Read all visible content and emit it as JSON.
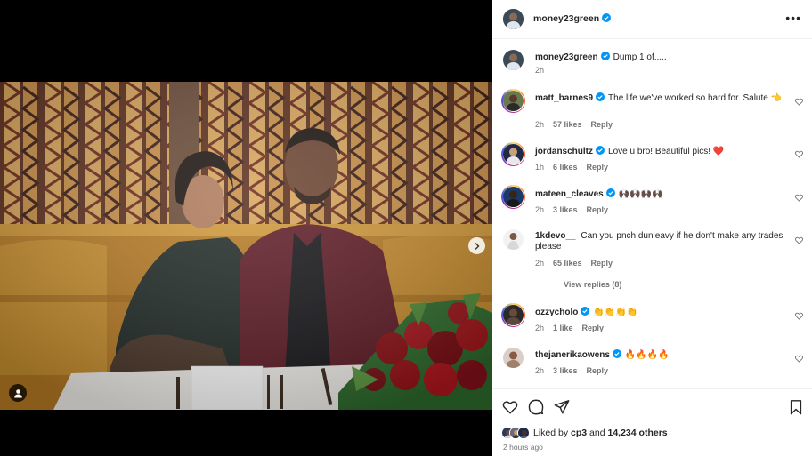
{
  "post": {
    "author": "money23green",
    "more_icon": "more-horizontal-icon",
    "caption": {
      "username": "money23green",
      "text": "Dump 1 of.....",
      "time": "2h"
    },
    "comments": [
      {
        "username": "matt_barnes9",
        "verified": true,
        "text": "The life we've worked so hard for. Salute 👈",
        "time": "2h",
        "likes": "57 likes",
        "reply": "Reply"
      },
      {
        "username": "jordanschultz",
        "verified": true,
        "text": "Love u bro! Beautiful pics! ❤️",
        "time": "1h",
        "likes": "6 likes",
        "reply": "Reply"
      },
      {
        "username": "mateen_cleaves",
        "verified": true,
        "text": "🙌🏿🙌🏿🙌🏿🙌🏿",
        "time": "2h",
        "likes": "3 likes",
        "reply": "Reply"
      },
      {
        "username": "1kdevo__",
        "verified": false,
        "text": "Can you pnch dunleavy if he don't make any trades please",
        "time": "2h",
        "likes": "65 likes",
        "reply": "Reply"
      },
      {
        "username": "ozzycholo",
        "verified": true,
        "text": "👏👏👏👏",
        "time": "2h",
        "likes": "1 like",
        "reply": "Reply"
      },
      {
        "username": "thejanerikaowens",
        "verified": true,
        "text": "🔥🔥🔥🔥",
        "time": "2h",
        "likes": "3 likes",
        "reply": "Reply"
      }
    ],
    "view_replies": "View replies (8)",
    "liked_by_prefix": "Liked by",
    "liked_by_user": "cp3",
    "liked_by_suffix": "and",
    "liked_by_others": "14,234 others",
    "posted_ago": "2 hours ago"
  },
  "icons": {
    "like": "heart-icon",
    "comment": "comment-icon",
    "share": "share-icon",
    "save": "bookmark-icon",
    "next": "chevron-right-icon",
    "tag": "user-tag-icon",
    "verified": "verified-badge-icon"
  },
  "colors": {
    "verified_blue": "#0095f6",
    "heart_red": "#ed4956",
    "secondary_text": "#737373"
  }
}
